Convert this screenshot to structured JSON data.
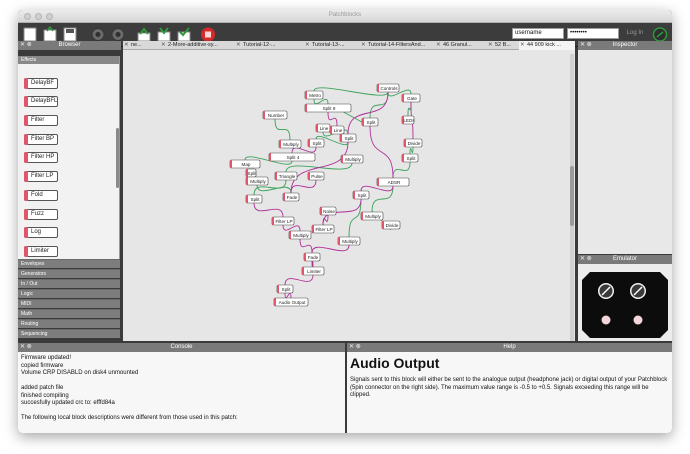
{
  "window": {
    "title": "Patchblocks"
  },
  "toolbar": {
    "username_value": "username",
    "password_value": "••••••••",
    "login_label": "Log In"
  },
  "browser": {
    "title": "Browser",
    "open_category": "Effects",
    "items": [
      "DelayBF",
      "DelayBFL",
      "Filter",
      "Filter BP",
      "Filter HP",
      "Filter LP",
      "Fold",
      "Fuzz",
      "Log",
      "Limiter"
    ],
    "categories": [
      "Envelopes",
      "Generators",
      "In / Out",
      "Logic",
      "MIDI",
      "Math",
      "Routing",
      "Sequencing"
    ]
  },
  "tabs": [
    {
      "label": "ne..."
    },
    {
      "label": "2-More-additive-sy..."
    },
    {
      "label": "Tutorial-12-..."
    },
    {
      "label": "Tutorial-13-..."
    },
    {
      "label": "Tutorial-14-FiltersAnd..."
    },
    {
      "label": "46 Granul..."
    },
    {
      "label": "52 B..."
    },
    {
      "label": "44 909 kick ..."
    }
  ],
  "inspector": {
    "title": "Inspector"
  },
  "emulator": {
    "title": "Emulator"
  },
  "console": {
    "title": "Console",
    "lines": [
      "Firmware updated!",
      "copied firmware",
      "Volume CRP DISABLD on disk4 unmounted",
      "",
      "added patch file",
      "finished compiling",
      "succesfully updated crc to: efffd84a",
      "",
      "The following local block descriptions were different from those used in this patch:"
    ]
  },
  "help": {
    "title": "Help",
    "heading": "Audio Output",
    "body": "Signals sent to this block will either be sent to the analogue output (headphone jack) or digital output of your Patchblock (5pin connector on the right side). The maximum value range is -0.5 to +0.5. Signals exceeding this range will be clipped."
  },
  "patch_blocks": [
    {
      "id": "controls",
      "label": "Controls"
    },
    {
      "id": "metro",
      "label": "Metro"
    },
    {
      "id": "gate",
      "label": "Gate"
    },
    {
      "id": "split1",
      "label": "Split 8"
    },
    {
      "id": "leds",
      "label": "LEDs"
    },
    {
      "id": "number",
      "label": "Number"
    },
    {
      "id": "split2",
      "label": "Split"
    },
    {
      "id": "line1",
      "label": "Line"
    },
    {
      "id": "line2",
      "label": "Line"
    },
    {
      "id": "split3",
      "label": "Split"
    },
    {
      "id": "divide1",
      "label": "Divide"
    },
    {
      "id": "multiply1",
      "label": "Multiply"
    },
    {
      "id": "split4",
      "label": "Split"
    },
    {
      "id": "split5",
      "label": "Split"
    },
    {
      "id": "split6",
      "label": "Split 4"
    },
    {
      "id": "multiply2",
      "label": "Multiply"
    },
    {
      "id": "split7",
      "label": "Split"
    },
    {
      "id": "map",
      "label": "Map"
    },
    {
      "id": "triangle",
      "label": "Triangle"
    },
    {
      "id": "pulse",
      "label": "Pulse"
    },
    {
      "id": "multiply3",
      "label": "Multiply"
    },
    {
      "id": "adsr",
      "label": "ADSR"
    },
    {
      "id": "split8",
      "label": "Split"
    },
    {
      "id": "fade1",
      "label": "Fade"
    },
    {
      "id": "split9",
      "label": "Split"
    },
    {
      "id": "noise",
      "label": "Noise"
    },
    {
      "id": "multiply4",
      "label": "Multiply"
    },
    {
      "id": "filterlp1",
      "label": "Filter LP"
    },
    {
      "id": "filterlp2",
      "label": "Filter LP"
    },
    {
      "id": "divide2",
      "label": "Divide"
    },
    {
      "id": "multiply5",
      "label": "Multiply"
    },
    {
      "id": "multiply6",
      "label": "Multiply"
    },
    {
      "id": "fade2",
      "label": "Fade"
    },
    {
      "id": "limiter",
      "label": "Limiter"
    },
    {
      "id": "split10",
      "label": "Split"
    },
    {
      "id": "audio_output",
      "label": "Audio Output"
    }
  ],
  "colors": {
    "block_port": "#e0566a",
    "wire_green": "#3aa35a",
    "wire_magenta": "#b0309a",
    "toolbar_bg": "#3c3c3c",
    "panel_header": "#7a7a7a"
  }
}
